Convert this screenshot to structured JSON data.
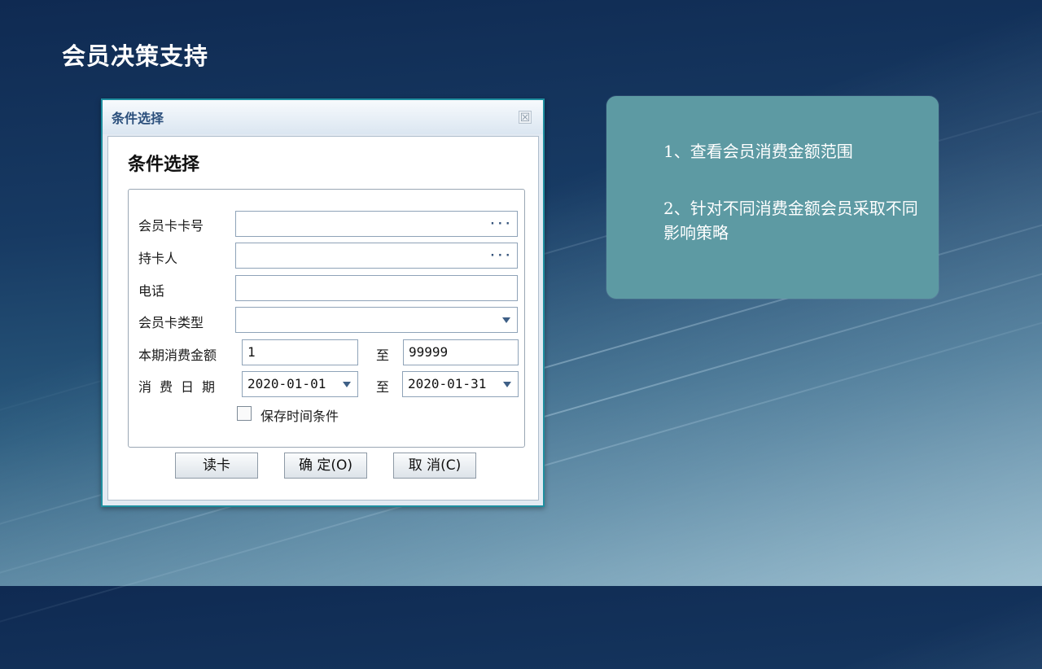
{
  "slide": {
    "title": "会员决策支持"
  },
  "dialog": {
    "window_title": "条件选择",
    "close_symbol": "☒",
    "heading": "条件选择",
    "fields": {
      "card_number": {
        "label": "会员卡卡号",
        "value": "",
        "button": "···"
      },
      "holder": {
        "label": "持卡人",
        "value": "",
        "button": "···"
      },
      "phone": {
        "label": "电话",
        "value": ""
      },
      "card_type": {
        "label": "会员卡类型",
        "value": ""
      },
      "amount": {
        "label": "本期消费金额",
        "from": "1",
        "to_label": "至",
        "to": "99999"
      },
      "date": {
        "label": "消费日期",
        "from": "2020-01-01",
        "to_label": "至",
        "to": "2020-01-31"
      }
    },
    "save_time_checkbox": {
      "label": "保存时间条件",
      "checked": false
    },
    "buttons": {
      "read_card": "读卡",
      "ok": "确 定(O)",
      "cancel": "取 消(C)"
    }
  },
  "panel": {
    "point1": "1、查看会员消费金额范围",
    "point2": "2、针对不同消费金额会员采取不同影响策略"
  },
  "colors": {
    "panel_bg": "#5d9aa3",
    "dialog_border": "#1f8fa0",
    "title_text": "#2b4f7c"
  }
}
